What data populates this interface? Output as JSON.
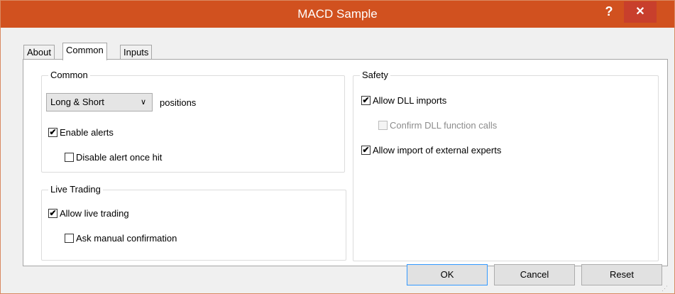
{
  "window": {
    "title": "MACD Sample",
    "help_label": "?",
    "close_label": "✕"
  },
  "tabs": [
    {
      "label": "About",
      "active": false
    },
    {
      "label": "Common",
      "active": true
    },
    {
      "label": "Inputs",
      "active": false
    }
  ],
  "common_group": {
    "title": "Common",
    "positions_select": {
      "value": "Long & Short",
      "chevron": "∨"
    },
    "positions_label": "positions",
    "enable_alerts": {
      "label": "Enable alerts",
      "checked": true
    },
    "disable_alert": {
      "label": "Disable alert once hit",
      "checked": false
    }
  },
  "live_trading_group": {
    "title": "Live Trading",
    "allow_live": {
      "label": "Allow live trading",
      "checked": true
    },
    "ask_manual": {
      "label": "Ask manual confirmation",
      "checked": false
    }
  },
  "safety_group": {
    "title": "Safety",
    "allow_dll": {
      "label": "Allow DLL imports",
      "checked": true
    },
    "confirm_dll": {
      "label": "Confirm DLL function calls",
      "checked": false,
      "disabled": true
    },
    "allow_import": {
      "label": "Allow import of external experts",
      "checked": true
    }
  },
  "buttons": {
    "ok": "OK",
    "cancel": "Cancel",
    "reset": "Reset"
  },
  "glyphs": {
    "check": "✔"
  },
  "colors": {
    "titlebar": "#d1511f",
    "close": "#c83f2c",
    "focus": "#3399ff"
  }
}
